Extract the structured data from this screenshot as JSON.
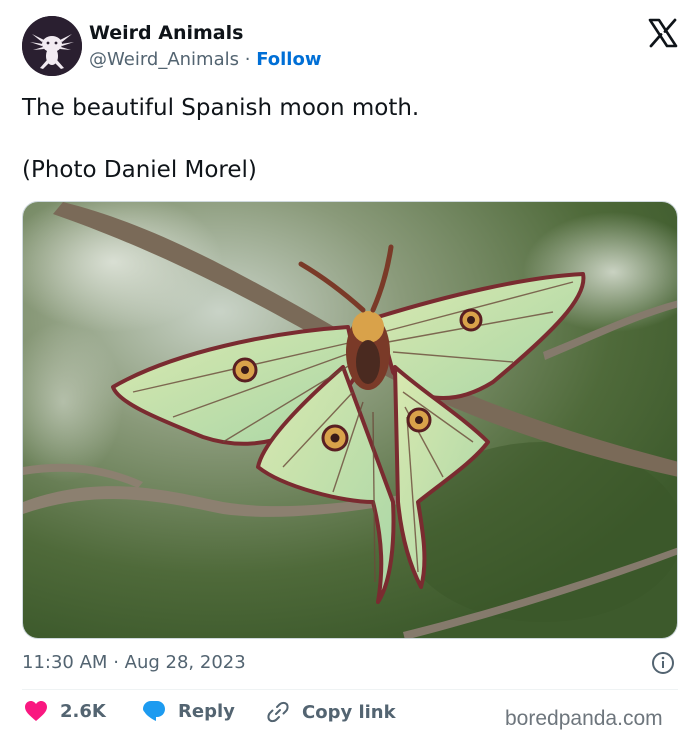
{
  "account": {
    "display_name": "Weird Animals",
    "handle": "@Weird_Animals",
    "separator": "·",
    "follow_label": "Follow",
    "avatar_icon": "axolotl-avatar"
  },
  "tweet": {
    "line1": "The beautiful Spanish moon moth.",
    "line2": "(Photo Daniel Morel)",
    "time": "11:30 AM",
    "dot": "·",
    "date": "Aug 28, 2023"
  },
  "actions": {
    "likes": "2.6K",
    "reply_label": "Reply",
    "copy_link_label": "Copy link"
  },
  "watermark": "boredpanda.com",
  "colors": {
    "follow": "#006fd6",
    "like": "#f91880",
    "reply": "#1d9bf0",
    "muted": "#536471"
  }
}
